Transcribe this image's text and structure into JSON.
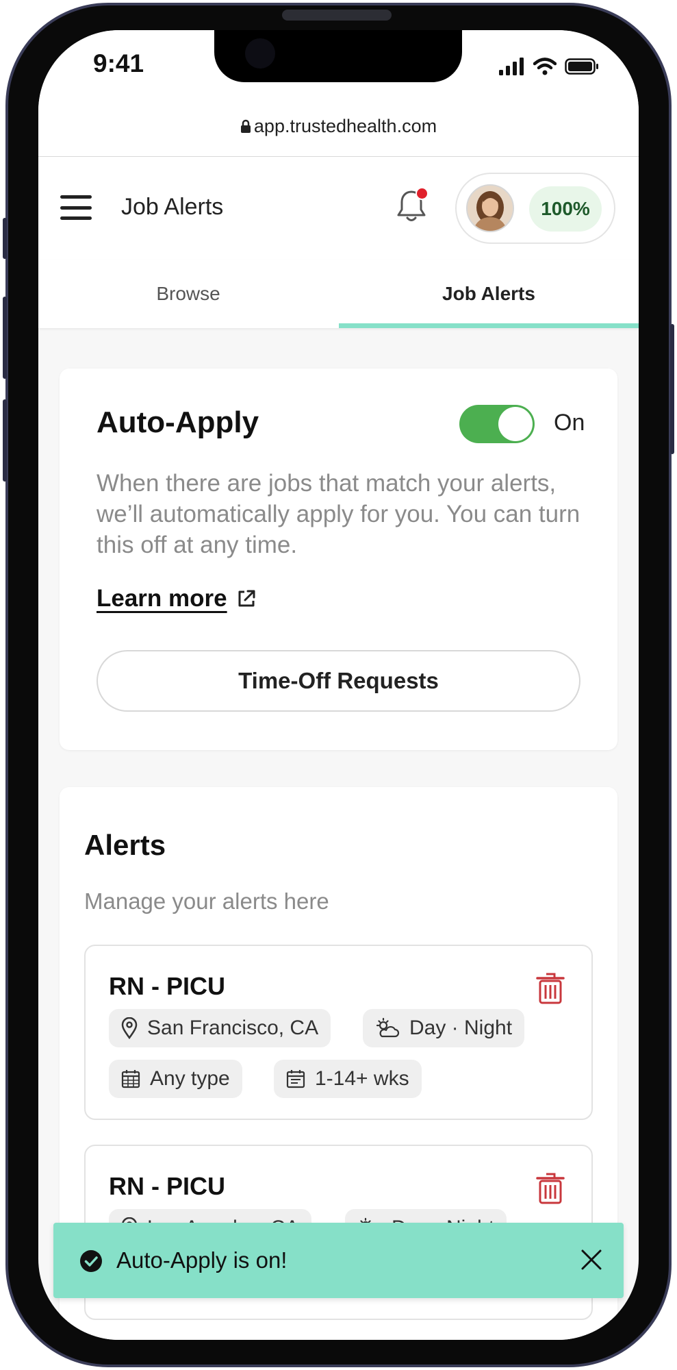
{
  "status_bar": {
    "time": "9:41"
  },
  "browser": {
    "url": "app.trustedhealth.com"
  },
  "header": {
    "title": "Job Alerts",
    "profile_completion": "100%"
  },
  "tabs": [
    {
      "label": "Browse",
      "active": false
    },
    {
      "label": "Job Alerts",
      "active": true
    }
  ],
  "auto_apply": {
    "title": "Auto-Apply",
    "toggle_state": "On",
    "enabled": true,
    "description": "When there are jobs that match your alerts, we’ll automatically apply for you. You can turn this off at any time.",
    "learn_more": "Learn more",
    "time_off_button": "Time-Off Requests"
  },
  "alerts": {
    "title": "Alerts",
    "subtitle": "Manage your alerts here",
    "items": [
      {
        "title": "RN - PICU",
        "location": "San Francisco, CA",
        "shift": "Day · Night",
        "type": "Any type",
        "duration": "1-14+ wks"
      },
      {
        "title": "RN - PICU",
        "location": "Los Angeles, CA",
        "shift": "Day · Night"
      }
    ]
  },
  "toast": {
    "message": "Auto-Apply is on!"
  },
  "colors": {
    "accent_mint": "#86e0c8",
    "toggle_green": "#4caf50",
    "delete_red": "#c8373c",
    "notification_red": "#e0202b",
    "completion_bg": "#e8f6e9",
    "completion_text": "#1e5a2b"
  }
}
